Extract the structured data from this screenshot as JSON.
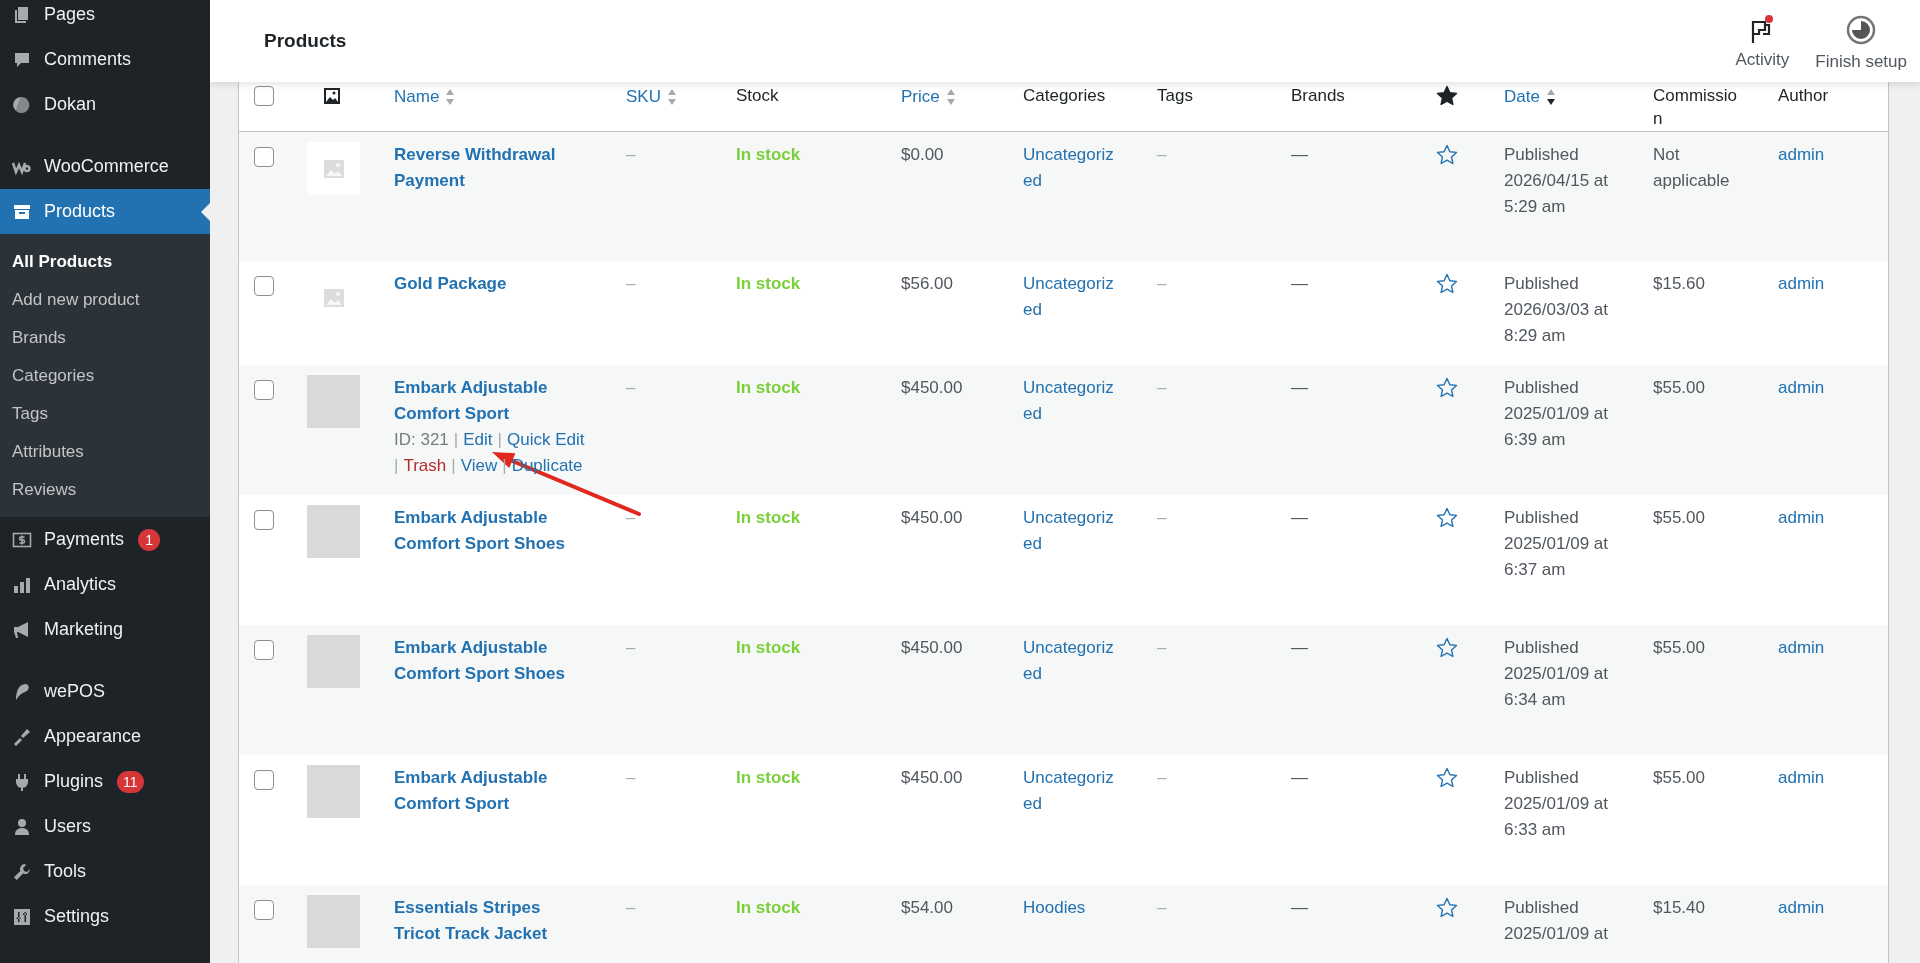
{
  "sidebar": {
    "groups": [
      [
        {
          "label": "Pages",
          "selected": false
        },
        {
          "label": "Comments",
          "selected": false
        },
        {
          "label": "Dokan",
          "selected": false
        }
      ],
      [
        {
          "label": "WooCommerce",
          "selected": false
        },
        {
          "label": "Products",
          "selected": true,
          "children": [
            {
              "label": "All Products",
              "selected": true
            },
            {
              "label": "Add new product",
              "selected": false
            },
            {
              "label": "Brands",
              "selected": false
            },
            {
              "label": "Categories",
              "selected": false
            },
            {
              "label": "Tags",
              "selected": false
            },
            {
              "label": "Attributes",
              "selected": false
            },
            {
              "label": "Reviews",
              "selected": false
            }
          ]
        },
        {
          "label": "Payments",
          "selected": false,
          "badge": "1"
        },
        {
          "label": "Analytics",
          "selected": false
        },
        {
          "label": "Marketing",
          "selected": false
        }
      ],
      [
        {
          "label": "wePOS",
          "selected": false
        },
        {
          "label": "Appearance",
          "selected": false
        },
        {
          "label": "Plugins",
          "selected": false,
          "badge": "11"
        },
        {
          "label": "Users",
          "selected": false
        },
        {
          "label": "Tools",
          "selected": false
        },
        {
          "label": "Settings",
          "selected": false
        }
      ]
    ]
  },
  "header": {
    "title": "Products",
    "actions": [
      {
        "label": "Activity",
        "unread": true
      },
      {
        "label": "Finish setup",
        "unread": false
      }
    ]
  },
  "table": {
    "columns": [
      {
        "kind": "checkbox",
        "checked": false
      },
      {
        "kind": "image"
      },
      {
        "kind": "text",
        "label": "Name",
        "sortable": true,
        "sorted_descending": false
      },
      {
        "kind": "text",
        "label": "SKU",
        "sortable": true,
        "sorted_descending": false
      },
      {
        "kind": "text",
        "label": "Stock",
        "sortable": false
      },
      {
        "kind": "text",
        "label": "Price",
        "sortable": true,
        "sorted_descending": false
      },
      {
        "kind": "text",
        "label": "Categories",
        "sortable": false
      },
      {
        "kind": "text",
        "label": "Tags",
        "sortable": false
      },
      {
        "kind": "text",
        "label": "Brands",
        "sortable": false
      },
      {
        "kind": "featured"
      },
      {
        "kind": "text",
        "label": "Date",
        "sortable": true,
        "sorted_descending": true
      },
      {
        "kind": "text",
        "label": "Commission",
        "sortable": false
      },
      {
        "kind": "text",
        "label": "Author",
        "sortable": false
      }
    ],
    "rows": [
      {
        "checked": false,
        "has_photo": false,
        "name": "Reverse Withdrawal Payment",
        "sku": "–",
        "stock": "In stock",
        "price": "$0.00",
        "categories": "Uncategorized",
        "tags": "–",
        "brands": "—",
        "featured": false,
        "date": "Published 2026/04/15 at 5:29 am",
        "commission": "Not applicable",
        "author": "admin"
      },
      {
        "checked": false,
        "has_photo": false,
        "name": "Gold Package",
        "sku": "–",
        "stock": "In stock",
        "price": "$56.00",
        "categories": "Uncategorized",
        "tags": "–",
        "brands": "—",
        "featured": false,
        "date": "Published 2026/03/03 at 8:29 am",
        "commission": "$15.60",
        "author": "admin"
      },
      {
        "checked": false,
        "has_photo": true,
        "name": "Embark Adjustable Comfort Sport",
        "actions": [
          [
            {
              "kind": "info",
              "label": "ID: 321"
            },
            {
              "kind": "separator",
              "label": "|"
            },
            {
              "kind": "link",
              "label": "Edit"
            },
            {
              "kind": "separator",
              "label": "|"
            },
            {
              "kind": "link",
              "label": "Quick Edit"
            }
          ],
          [
            {
              "kind": "separator",
              "label": "|"
            },
            {
              "kind": "delete",
              "label": "Trash"
            },
            {
              "kind": "separator",
              "label": "|"
            },
            {
              "kind": "link",
              "label": "View"
            },
            {
              "kind": "separator",
              "label": "|"
            },
            {
              "kind": "link",
              "label": "Duplicate"
            }
          ]
        ],
        "sku": "–",
        "stock": "In stock",
        "price": "$450.00",
        "categories": "Uncategorized",
        "tags": "–",
        "brands": "—",
        "featured": false,
        "date": "Published 2025/01/09 at 6:39 am",
        "commission": "$55.00",
        "author": "admin"
      },
      {
        "checked": false,
        "has_photo": true,
        "name": "Embark Adjustable Comfort Sport Shoes",
        "sku": "–",
        "stock": "In stock",
        "price": "$450.00",
        "categories": "Uncategorized",
        "tags": "–",
        "brands": "—",
        "featured": false,
        "date": "Published 2025/01/09 at 6:37 am",
        "commission": "$55.00",
        "author": "admin"
      },
      {
        "checked": false,
        "has_photo": true,
        "name": "Embark Adjustable Comfort Sport Shoes",
        "sku": "–",
        "stock": "In stock",
        "price": "$450.00",
        "categories": "Uncategorized",
        "tags": "–",
        "brands": "—",
        "featured": false,
        "date": "Published 2025/01/09 at 6:34 am",
        "commission": "$55.00",
        "author": "admin"
      },
      {
        "checked": false,
        "has_photo": true,
        "name": "Embark Adjustable Comfort Sport",
        "sku": "–",
        "stock": "In stock",
        "price": "$450.00",
        "categories": "Uncategorized",
        "tags": "–",
        "brands": "—",
        "featured": false,
        "date": "Published 2025/01/09 at 6:33 am",
        "commission": "$55.00",
        "author": "admin"
      },
      {
        "checked": false,
        "has_photo": true,
        "name": "Essentials Stripes Tricot Track Jacket",
        "sku": "–",
        "stock": "In stock",
        "price": "$54.00",
        "categories": "Hoodies",
        "tags": "–",
        "brands": "—",
        "featured": false,
        "date": "Published 2025/01/09 at",
        "commission": "$15.40",
        "author": "admin"
      }
    ]
  }
}
